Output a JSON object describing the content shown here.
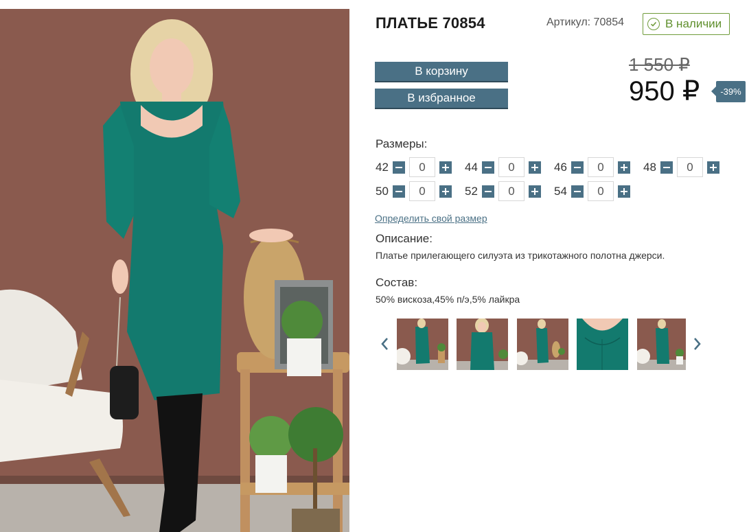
{
  "product": {
    "title": "ПЛАТЬЕ 70854",
    "sku": "Артикул: 70854",
    "stock_label": "В наличии",
    "stock_icon": "check-circle-icon"
  },
  "actions": {
    "cart_label": "В корзину",
    "favorite_label": "В избранное"
  },
  "pricing": {
    "old_price": "1 550 ₽",
    "price": "950 ₽",
    "discount": "-39%"
  },
  "sizes": {
    "label": "Размеры:",
    "items": [
      {
        "size": "42",
        "qty": "0"
      },
      {
        "size": "44",
        "qty": "0"
      },
      {
        "size": "46",
        "qty": "0"
      },
      {
        "size": "48",
        "qty": "0"
      },
      {
        "size": "50",
        "qty": "0"
      },
      {
        "size": "52",
        "qty": "0"
      },
      {
        "size": "54",
        "qty": "0"
      }
    ],
    "size_link": "Определить свой размер"
  },
  "description": {
    "label": "Описание:",
    "text": "Платье прилегающего силуэта из трикотажного полотна джерси."
  },
  "composition": {
    "label": "Состав:",
    "text": "50% вискоза,45% п/э,5% лайкра"
  },
  "gallery": {
    "prev_icon": "chevron-left-icon",
    "next_icon": "chevron-right-icon",
    "thumb_count": 5
  },
  "colors": {
    "accent": "#4a7085",
    "stock_green": "#6f9b3a",
    "dress": "#137a6e",
    "wall": "#8a5a4e"
  }
}
